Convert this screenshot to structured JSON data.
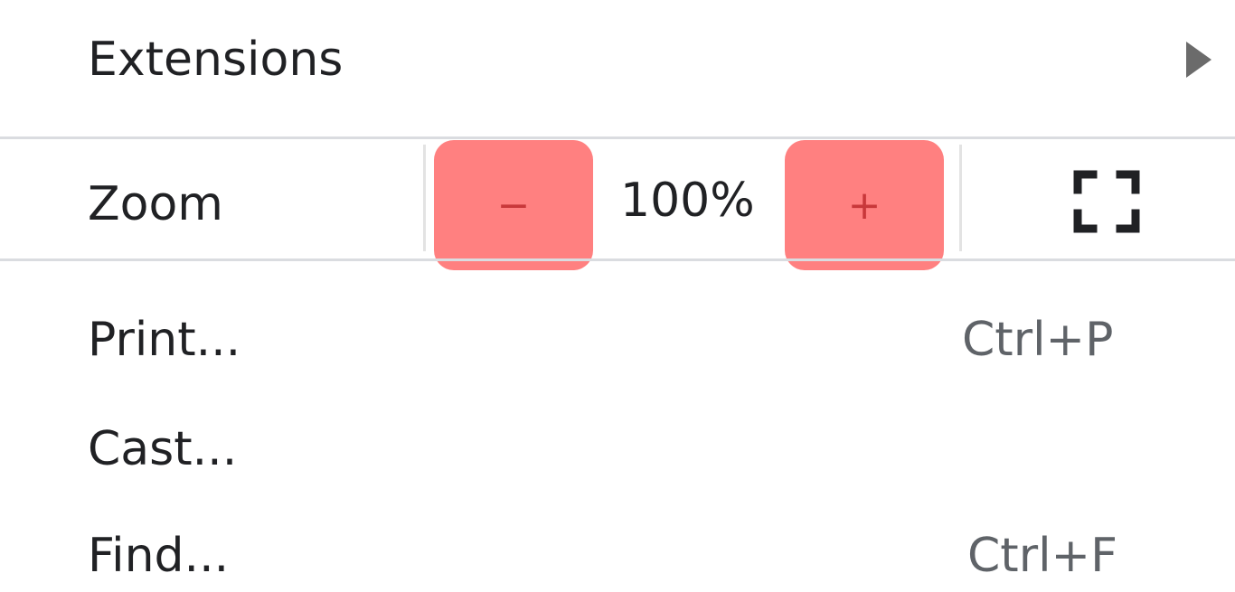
{
  "menu": {
    "extensions_label": "Extensions",
    "zoom": {
      "label": "Zoom",
      "decrease_label": "−",
      "value": "100%",
      "increase_label": "+",
      "highlight_color": "#ff8080"
    },
    "print": {
      "label": "Print...",
      "shortcut": "Ctrl+P"
    },
    "cast": {
      "label": "Cast..."
    },
    "find": {
      "label": "Find...",
      "shortcut": "Ctrl+F"
    }
  },
  "icons": {
    "submenu": "chevron-right-icon",
    "fullscreen": "fullscreen-icon"
  }
}
